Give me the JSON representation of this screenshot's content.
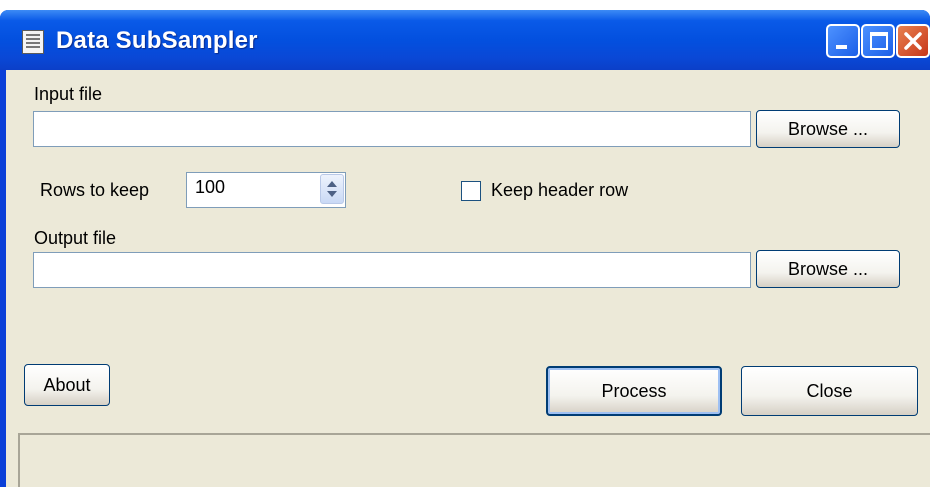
{
  "window": {
    "title": "Data SubSampler",
    "icon": "table-icon"
  },
  "controls": {
    "minimize": "minimize-icon",
    "maximize": "maximize-icon",
    "close": "close-icon"
  },
  "form": {
    "input_label": "Input file",
    "input_value": "",
    "browse_input_label": "Browse ...",
    "rows_label": "Rows to keep",
    "rows_value": "100",
    "keep_header_label": "Keep header row",
    "keep_header_checked": false,
    "output_label": "Output file",
    "output_value": "",
    "browse_output_label": "Browse ..."
  },
  "buttons": {
    "about": "About",
    "process": "Process",
    "close": "Close"
  },
  "colors": {
    "titlebar": "#0350df",
    "face": "#ece9d8",
    "close_button": "#c7371a"
  }
}
